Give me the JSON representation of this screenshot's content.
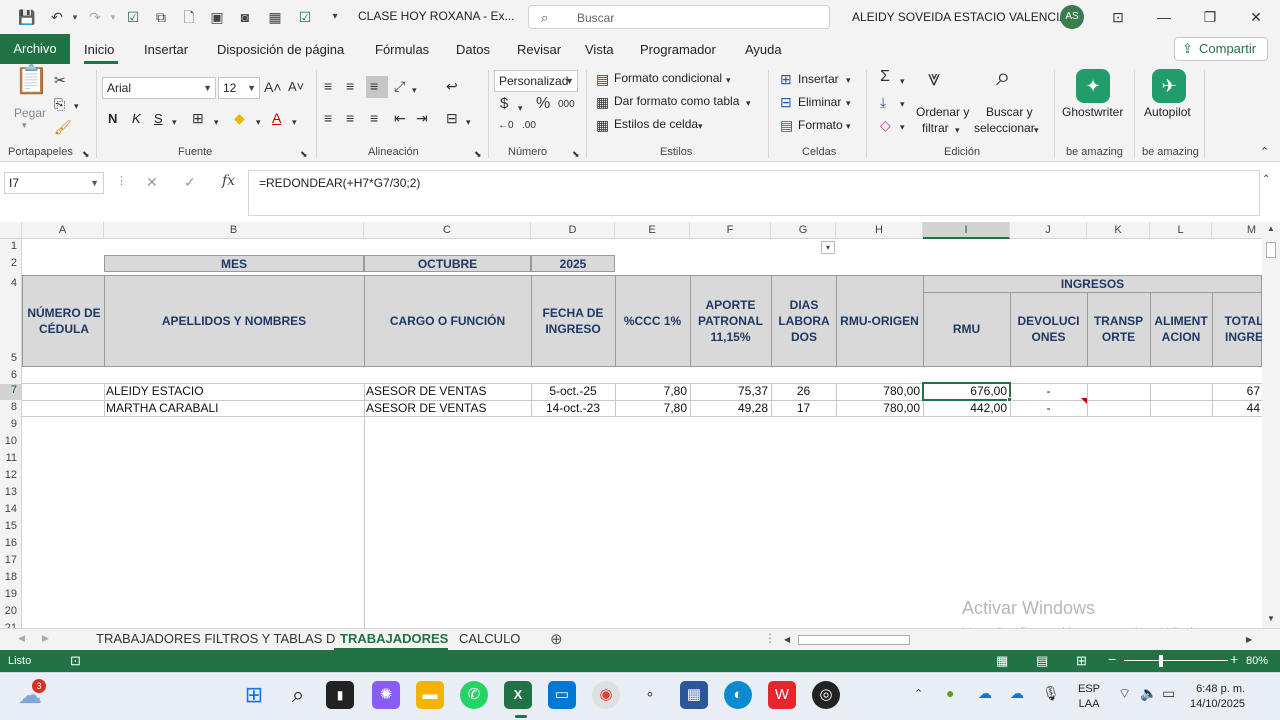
{
  "titlebar": {
    "doc_title": "CLASE HOY ROXANA  -  Ex...",
    "search_placeholder": "Buscar",
    "user_name": "ALEIDY SOVEIDA ESTACIO VALENCIA",
    "avatar_initials": "AS"
  },
  "ribbon_tabs": [
    "Archivo",
    "Inicio",
    "Insertar",
    "Disposición de página",
    "Fórmulas",
    "Datos",
    "Revisar",
    "Vista",
    "Programador",
    "Ayuda"
  ],
  "share_label": "Compartir",
  "ribbon": {
    "paste_label": "Pegar",
    "font_name": "Arial",
    "font_size": "12",
    "bold": "N",
    "italic": "K",
    "underline": "S",
    "number_format": "Personalizad",
    "conditional_format": "Formato condicional",
    "format_as_table": "Dar formato como tabla",
    "cell_styles": "Estilos de celda",
    "insert": "Insertar",
    "delete": "Eliminar",
    "format": "Formato",
    "sort_filter_1": "Ordenar y",
    "sort_filter_2": "filtrar",
    "find_select_1": "Buscar y",
    "find_select_2": "seleccionar",
    "ghostwriter": "Ghostwriter",
    "autopilot": "Autopilot",
    "groups": {
      "clipboard": "Portapapeles",
      "font": "Fuente",
      "alignment": "Alineación",
      "number": "Número",
      "styles": "Estilos",
      "cells": "Celdas",
      "editing": "Edición",
      "be_amazing_1": "be amazing",
      "be_amazing_2": "be amazing"
    }
  },
  "formula_bar": {
    "name_box": "I7",
    "formula": "=REDONDEAR(+H7*G7/30;2)"
  },
  "columns": [
    "A",
    "B",
    "C",
    "D",
    "E",
    "F",
    "G",
    "H",
    "I",
    "J",
    "K",
    "L",
    "M"
  ],
  "rows": [
    "1",
    "2",
    "4",
    "5",
    "6",
    "7",
    "8",
    "9",
    "10",
    "11",
    "12",
    "13",
    "14",
    "15",
    "16",
    "17",
    "18",
    "19",
    "20",
    "21"
  ],
  "sheet": {
    "row2": {
      "mes_label": "MES",
      "mes_value": "OCTUBRE",
      "year": "2025"
    },
    "ingresos_label": "INGRESOS",
    "headers": {
      "cedula": "NÚMERO DE CÉDULA",
      "nombres": "APELLIDOS Y NOMBRES",
      "cargo": "CARGO O FUNCIÓN",
      "fecha": "FECHA DE INGRESO",
      "ccc": "%CCC 1%",
      "aporte": "APORTE PATRONAL 11,15%",
      "dias": "DIAS LABORA DOS",
      "rmu_origen": "RMU-ORIGEN",
      "rmu": "RMU",
      "devoluciones": "DEVOLUCI ONES",
      "transporte": "TRANSP ORTE",
      "alimentacion": "ALIMENT ACION",
      "total": "TOTAL INGRE"
    },
    "data_rows": [
      {
        "nombre": "ALEIDY ESTACIO",
        "cargo": "ASESOR DE VENTAS",
        "fecha": "5-oct.-25",
        "ccc": "7,80",
        "aporte": "75,37",
        "dias": "26",
        "rmu_origen": "780,00",
        "rmu": "676,00",
        "dev": "-",
        "total": "67"
      },
      {
        "nombre": "MARTHA CARABALI",
        "cargo": "ASESOR DE VENTAS",
        "fecha": "14-oct.-23",
        "ccc": "7,80",
        "aporte": "49,28",
        "dias": "17",
        "rmu_origen": "780,00",
        "rmu": "442,00",
        "dev": "-",
        "total": "44"
      }
    ]
  },
  "sheet_tabs": [
    "TRABAJADORES FILTROS Y TABLAS D",
    "TRABAJADORES",
    "CALCULO"
  ],
  "status": {
    "ready": "Listo",
    "zoom": "80%"
  },
  "watermark": {
    "line1": "Activar Windows",
    "line2": "Ve a Configuración para activar Windows."
  },
  "taskbar": {
    "weather_badge": "3",
    "lang_1": "ESP",
    "lang_2": "LAA",
    "time": "6:48 p. m.",
    "date": "14/10/2025"
  },
  "colors": {
    "excel_green": "#217346",
    "header_fill": "#d9d9d9",
    "header_text": "#1f3864"
  }
}
